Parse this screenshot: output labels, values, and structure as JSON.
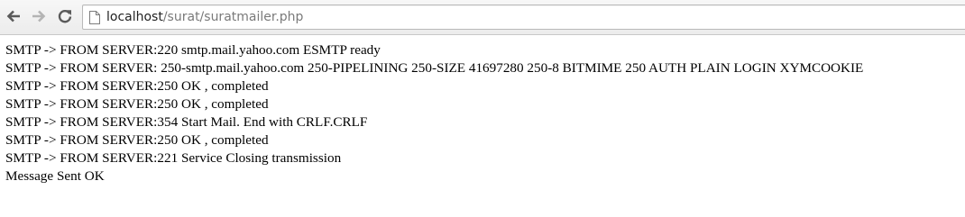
{
  "browser": {
    "icons": {
      "back": "back-arrow-icon",
      "forward": "forward-arrow-icon",
      "reload": "reload-icon",
      "page": "page-icon"
    },
    "url_host": "localhost",
    "url_path": "/surat/suratmailer.php"
  },
  "page": {
    "lines": [
      "SMTP -> FROM SERVER:220 smtp.mail.yahoo.com ESMTP ready",
      "SMTP -> FROM SERVER: 250-smtp.mail.yahoo.com 250-PIPELINING 250-SIZE 41697280 250-8 BITMIME 250 AUTH PLAIN LOGIN XYMCOOKIE",
      "SMTP -> FROM SERVER:250 OK , completed",
      "SMTP -> FROM SERVER:250 OK , completed",
      "SMTP -> FROM SERVER:354 Start Mail. End with CRLF.CRLF",
      "SMTP -> FROM SERVER:250 OK , completed",
      "SMTP -> FROM SERVER:221 Service Closing transmission",
      "Message Sent OK"
    ]
  }
}
